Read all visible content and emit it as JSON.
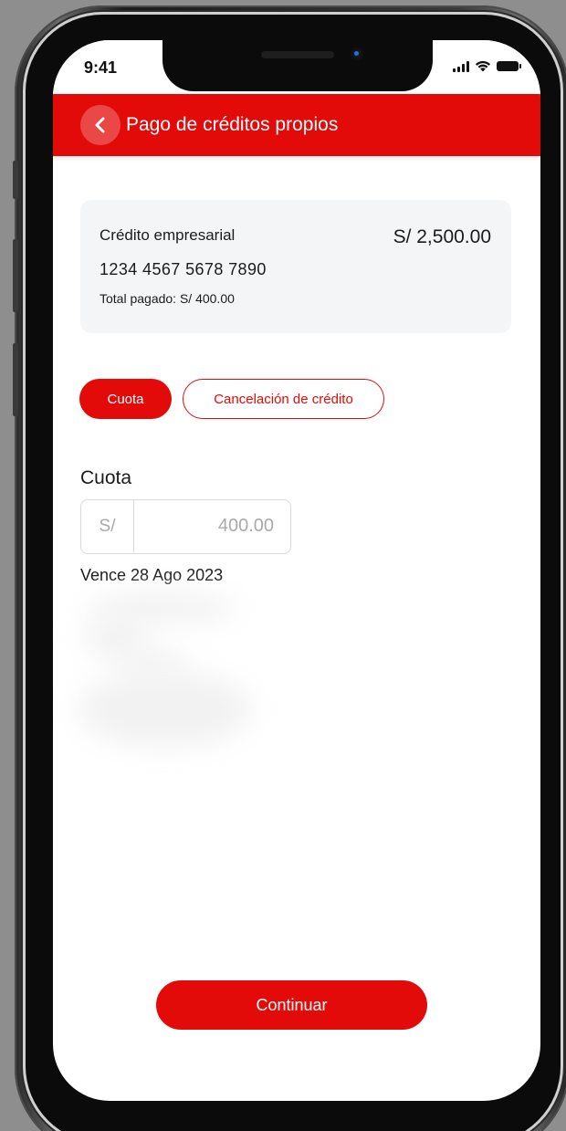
{
  "status_bar": {
    "time": "9:41"
  },
  "header": {
    "title": "Pago de créditos propios",
    "back_icon": "chevron-left-icon",
    "background_color": "#e30a0a"
  },
  "credit": {
    "name": "Crédito empresarial",
    "amount": "S/ 2,500.00",
    "number": "1234 4567 5678 7890",
    "total_paid": "Total pagado: S/ 400.00"
  },
  "payment_options": {
    "selected": "Cuota",
    "items": [
      {
        "label": "Cuota",
        "active": true
      },
      {
        "label": "Cancelación de crédito",
        "active": false
      }
    ]
  },
  "installment": {
    "title": "Cuota",
    "currency_prefix": "S/",
    "amount": "400.00",
    "due_date": "Vence 28 Ago 2023"
  },
  "actions": {
    "continue_label": "Continuar"
  },
  "colors": {
    "accent": "#e30a0a",
    "card_background": "#f4f5f7",
    "input_border": "#d9d9d9",
    "muted_text": "#a9a9a9"
  }
}
